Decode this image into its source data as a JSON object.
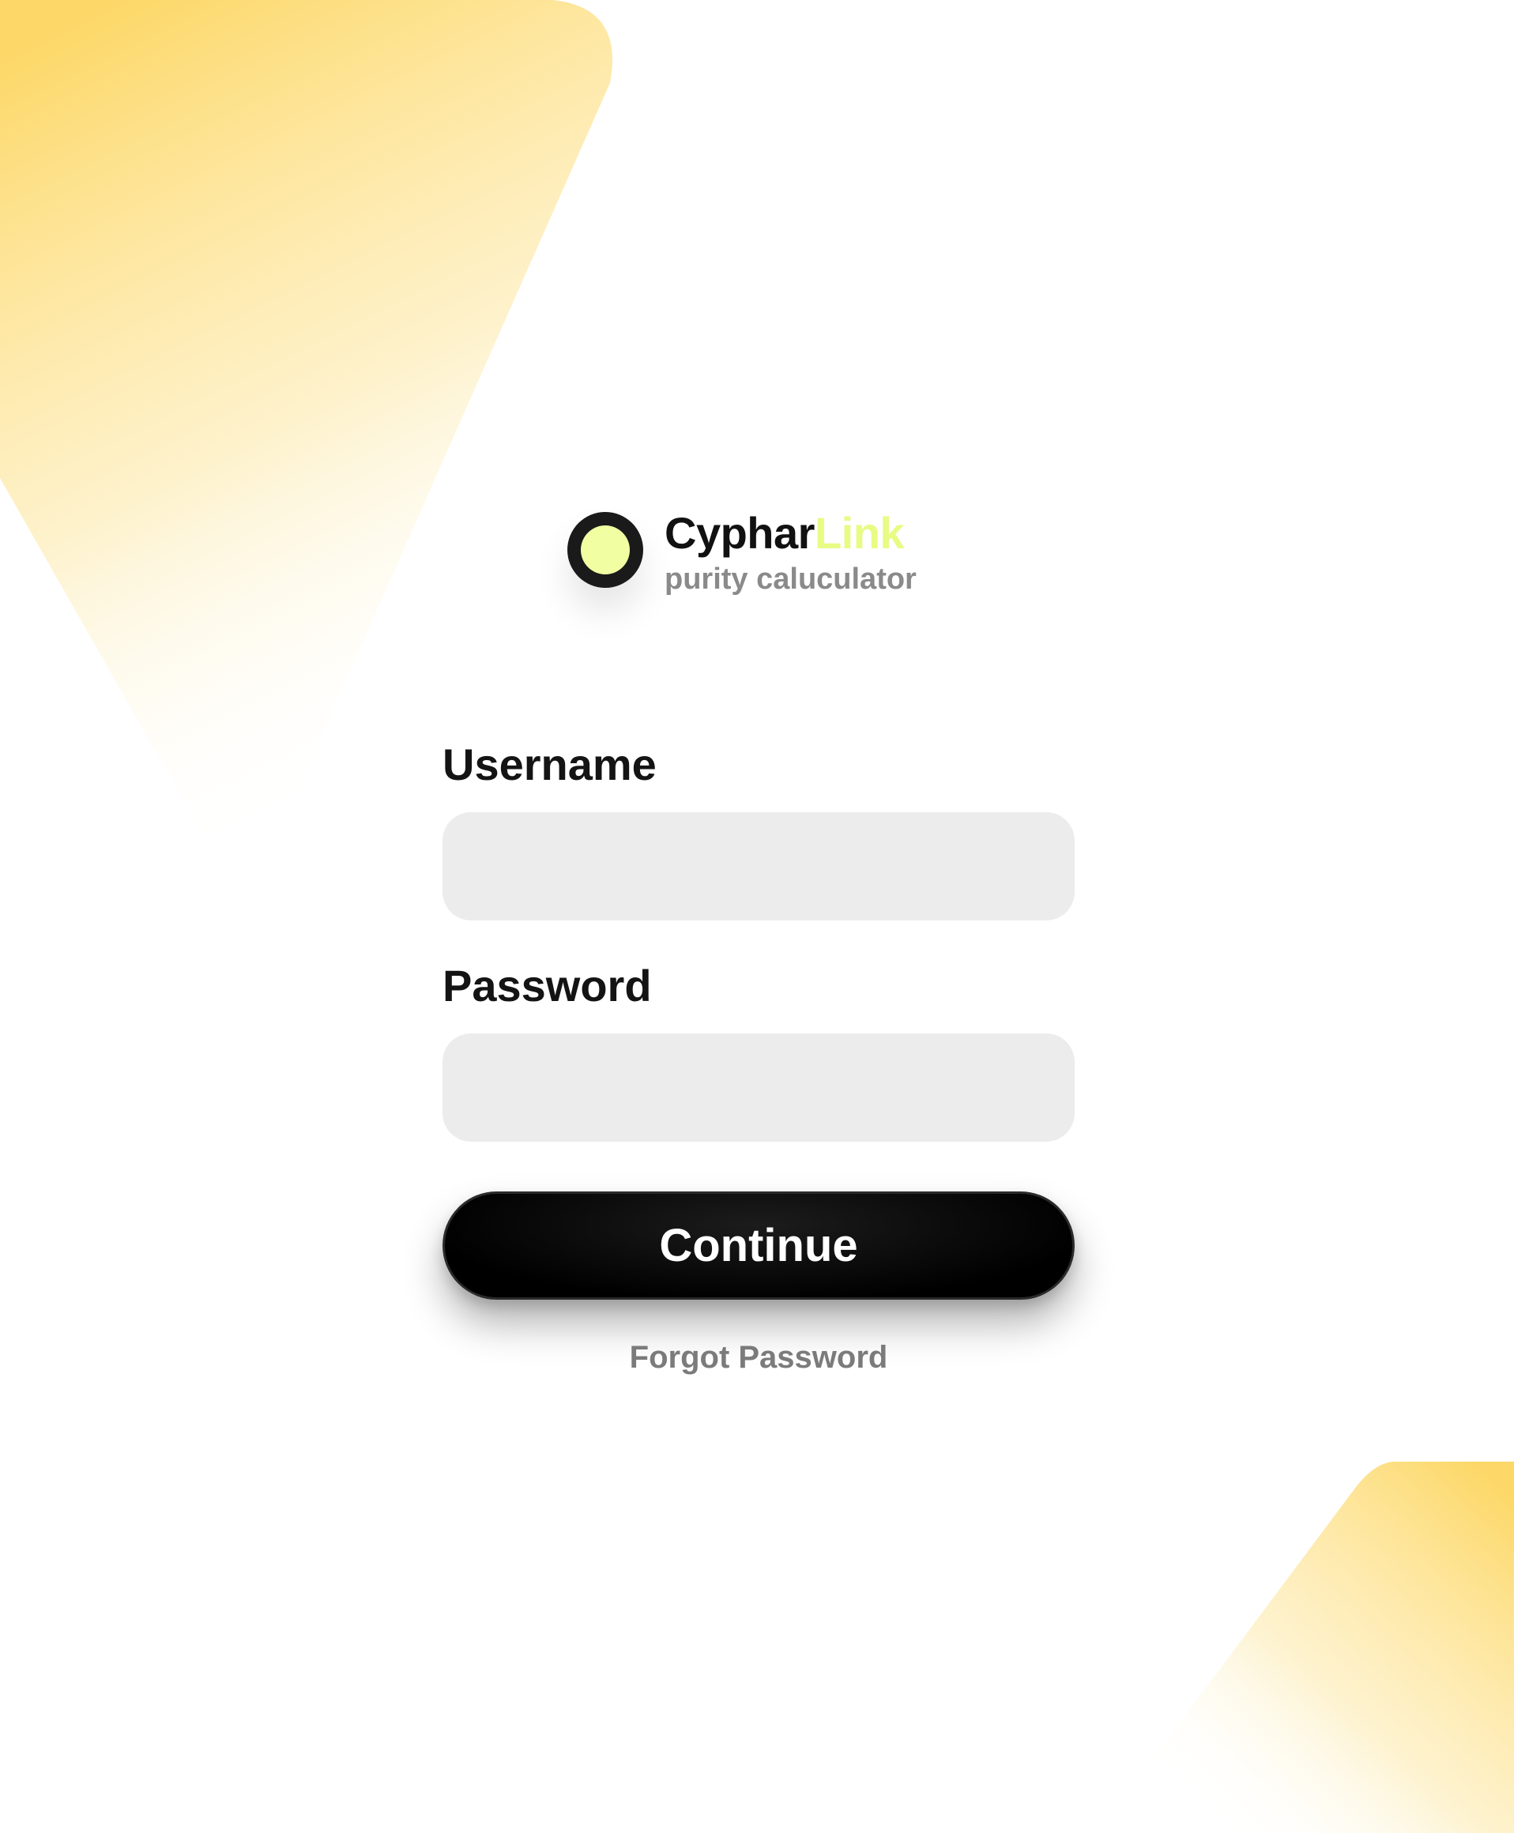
{
  "brand": {
    "name_primary": "Cyphar",
    "name_accent": "Link",
    "tagline": "purity caluculator"
  },
  "form": {
    "username_label": "Username",
    "username_value": "",
    "password_label": "Password",
    "password_value": "",
    "continue_label": "Continue",
    "forgot_label": "Forgot Password"
  },
  "colors": {
    "accent": "#e8fb83",
    "logo_inner": "#f1ffa2",
    "background_gradient": "#fdd868",
    "button": "#000000",
    "input_background": "#ececec"
  },
  "icons": {
    "logo": "ring-logo-icon"
  }
}
